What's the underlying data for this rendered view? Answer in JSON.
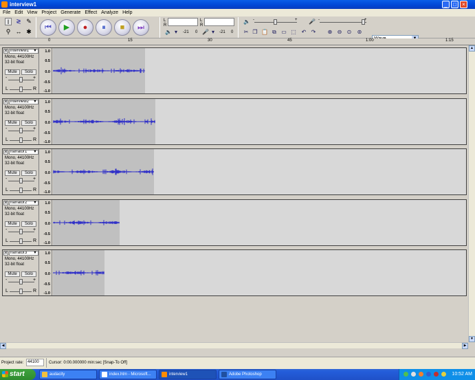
{
  "window": {
    "title": "interview1",
    "min": "_",
    "max": "□",
    "close": "×"
  },
  "menu": [
    "File",
    "Edit",
    "View",
    "Project",
    "Generate",
    "Effect",
    "Analyze",
    "Help"
  ],
  "toolbar": {
    "tools": {
      "select": "I",
      "envelope": "≷",
      "draw": "✎",
      "zoom": "⚲",
      "timeshift": "↔",
      "multi": "✱"
    },
    "transport": {
      "rewind": "⏮",
      "play": "▶",
      "record": "●",
      "pause": "⏸",
      "stop": "■",
      "forward": "⏭"
    },
    "meter": {
      "L": "L",
      "R": "R",
      "scale_a": "-21",
      "scale_b": "0",
      "scale_c": "-21",
      "scale_d": "0"
    },
    "mixer": {
      "minus": "-",
      "plus": "+"
    },
    "device": "Wave"
  },
  "ruler": {
    "labels": [
      "0",
      "15",
      "30",
      "45",
      "1:00",
      "1:15"
    ]
  },
  "track_common": {
    "format": "Mono, 44100Hz",
    "bits": "32-bit float",
    "mute": "Mute",
    "solo": "Solo",
    "gain_minus": "-",
    "gain_plus": "+",
    "pan_l": "L",
    "pan_r": "R",
    "close": "×",
    "dropdown": "▼",
    "vscale": [
      "1.0",
      "0.5",
      "0.0",
      "-0.5",
      "-1.0"
    ]
  },
  "tracks": [
    {
      "name": "interview1",
      "length_sec": 34.5
    },
    {
      "name": "interview2",
      "length_sec": 38.5
    },
    {
      "name": "narrator1",
      "length_sec": 38.0
    },
    {
      "name": "narrator2",
      "length_sec": 25.0
    },
    {
      "name": "narrator3",
      "length_sec": 19.5
    }
  ],
  "status": {
    "rate_label": "Project rate:",
    "rate_value": "44100",
    "cursor": "Cursor: 0:00.000000 min:sec  [Snap-To Off]"
  },
  "taskbar": {
    "start": "start",
    "tasks": [
      "audacity",
      "index.htm - Microsoft...",
      "interview1",
      "Adobe Photoshop"
    ],
    "clock": "10:52 AM"
  },
  "colors": {
    "waveform": "#3232c8",
    "selection": "#c0c0c0",
    "track_bg": "#d8d8d8"
  }
}
